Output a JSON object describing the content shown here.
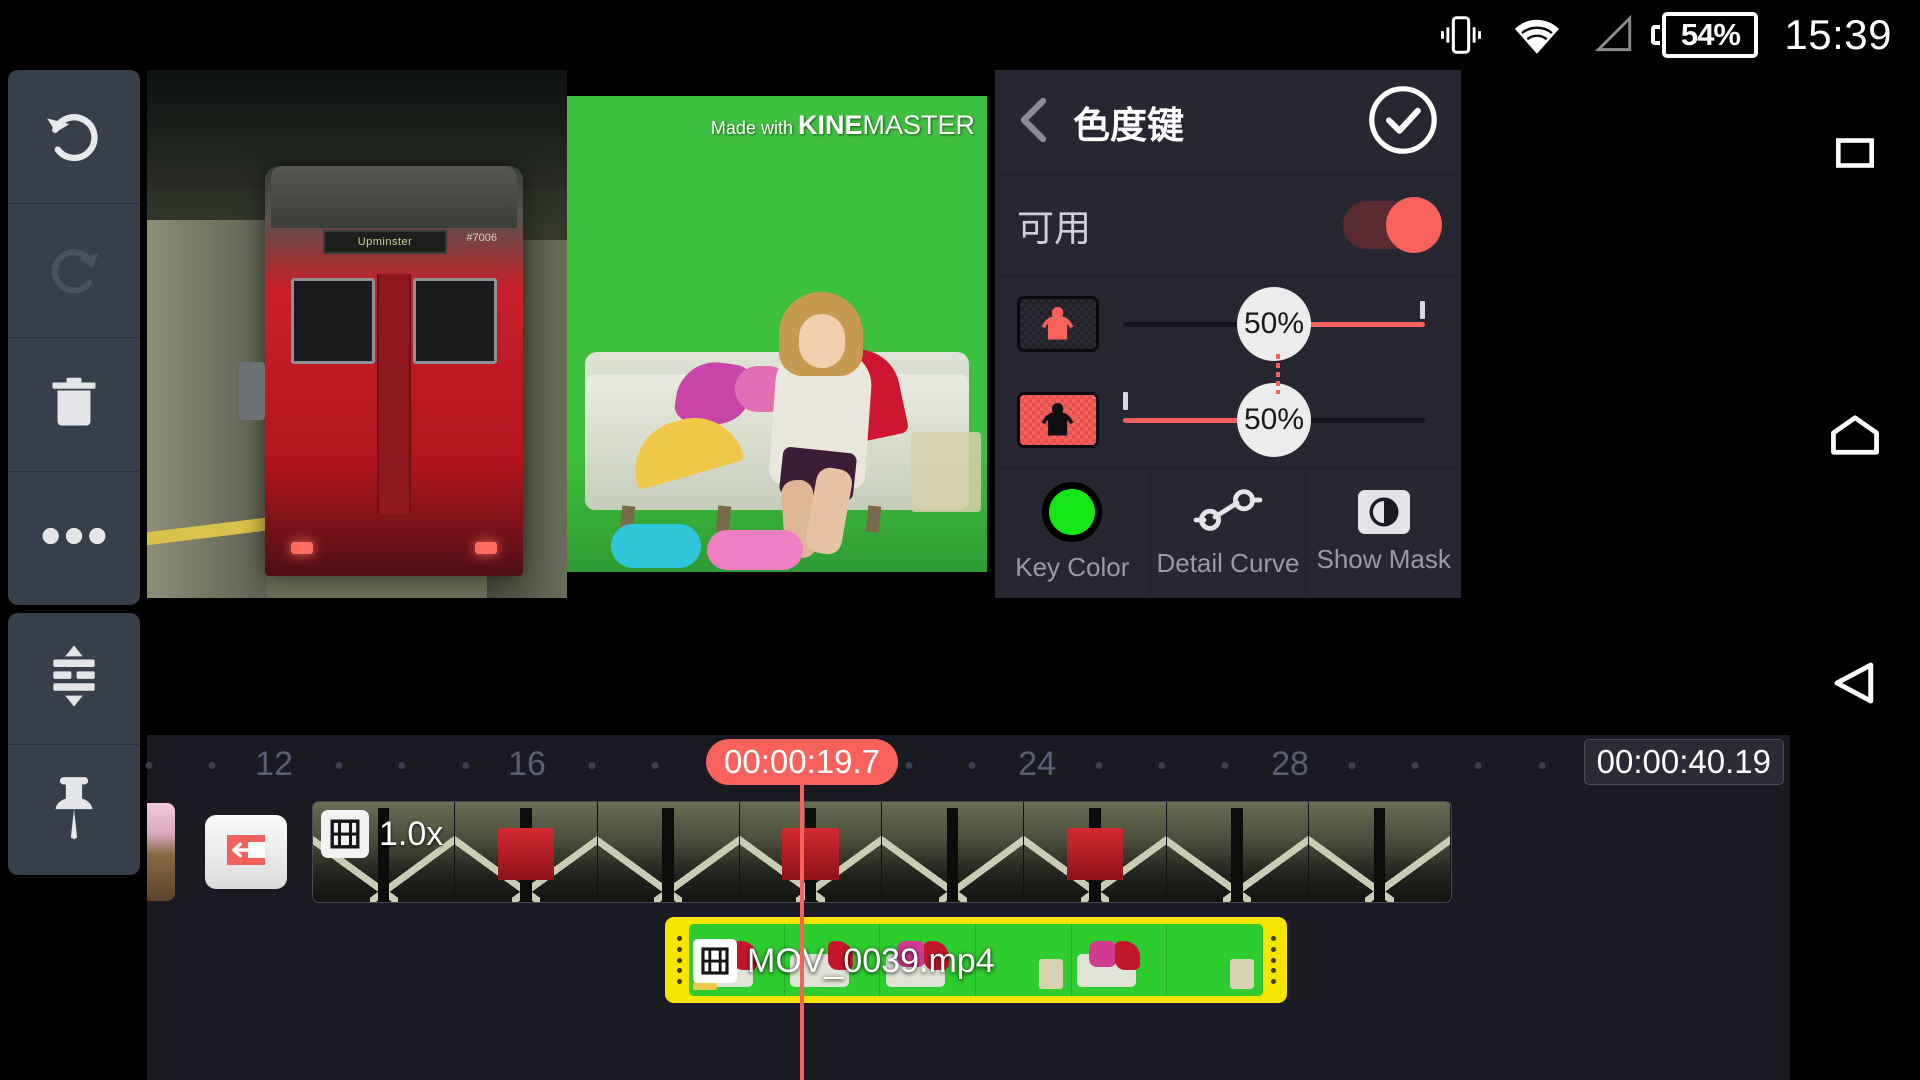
{
  "status_bar": {
    "vibrate_icon": "vibrate-icon",
    "wifi_icon": "wifi-icon",
    "signal_icon": "signal-icon",
    "battery_level": "54%",
    "clock": "15:39"
  },
  "nav_bar": {
    "recents": "recents-icon",
    "home": "home-icon",
    "back": "back-icon"
  },
  "left_toolbar": {
    "items": [
      {
        "name": "undo",
        "icon": "undo-icon",
        "enabled": true
      },
      {
        "name": "redo",
        "icon": "redo-icon",
        "enabled": false
      },
      {
        "name": "delete",
        "icon": "trash-icon",
        "enabled": true
      },
      {
        "name": "more",
        "icon": "more-options-icon",
        "enabled": true
      }
    ],
    "items2": [
      {
        "name": "expand-tracks",
        "icon": "expand-tracks-icon"
      },
      {
        "name": "pin",
        "icon": "pin-icon"
      }
    ]
  },
  "preview": {
    "watermark_made": "Made with ",
    "watermark_kine": "KINE",
    "watermark_master": "MASTER",
    "train_destination": "Upminster",
    "train_number": "#7006"
  },
  "panel": {
    "back_icon": "chevron-left-icon",
    "title": "色度键",
    "confirm_icon": "check-circle-icon",
    "enable_label": "可用",
    "enable_on": true,
    "sliders": [
      {
        "name": "foreground-threshold",
        "thumb_icon": "figure-transparent-icon",
        "value": "50%",
        "percent": 50,
        "tick_percent": 100,
        "fill_from": 50
      },
      {
        "name": "background-threshold",
        "thumb_icon": "figure-silhouette-icon",
        "value": "50%",
        "percent": 50,
        "tick_percent": 0,
        "fill_from": 0
      }
    ],
    "tabs": [
      {
        "name": "key-color",
        "label": "Key Color",
        "icon": "color-swatch-icon",
        "color": "#16e716"
      },
      {
        "name": "detail-curve",
        "label": "Detail Curve",
        "icon": "curve-icon"
      },
      {
        "name": "show-mask",
        "label": "Show Mask",
        "icon": "mask-contrast-icon"
      }
    ]
  },
  "timeline": {
    "ruler_numbers": [
      "12",
      "16",
      "24",
      "28"
    ],
    "playhead_time": "00:00:19.7",
    "total_time": "00:00:40.19",
    "main_clip_speed": "1.0x",
    "main_clip_icon": "film-icon",
    "transition_icon": "transition-icon",
    "overlay_clip_name": "MOV_0039.mp4",
    "overlay_clip_icon": "film-icon"
  },
  "colors": {
    "accent_red": "#f8615c",
    "panel_bg": "#272733",
    "toolbar_bg": "#373e4c",
    "timeline_bg": "#191a22",
    "clip_yellow": "#f5e500",
    "key_green": "#16e716"
  }
}
